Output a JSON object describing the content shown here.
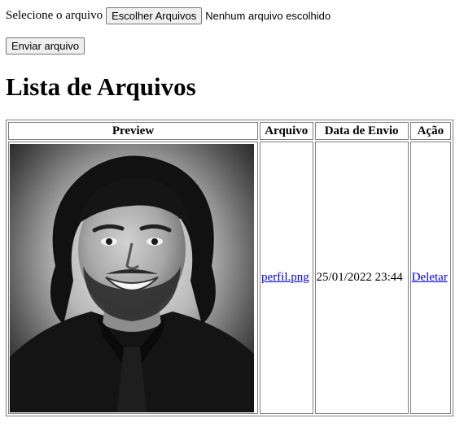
{
  "form": {
    "file_label": "Selecione o arquivo",
    "choose_button": "Escolher Arquivos",
    "no_file_text": "Nenhum arquivo escolhido",
    "submit_button": "Enviar arquivo"
  },
  "heading": "Lista de Arquivos",
  "table": {
    "headers": [
      "Preview",
      "Arquivo",
      "Data de Envio",
      "Ação"
    ],
    "rows": [
      {
        "filename": "perfil.png",
        "date": "25/01/2022 23:44",
        "action": "Deletar"
      }
    ]
  }
}
